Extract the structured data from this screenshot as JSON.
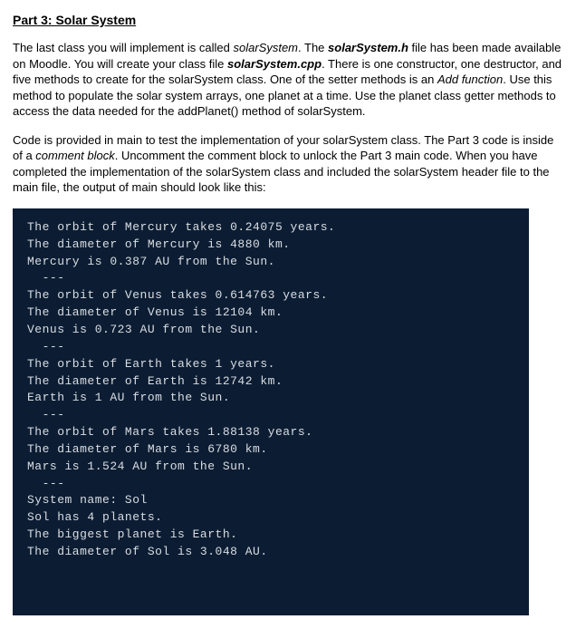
{
  "heading": "Part 3: Solar System",
  "para1": {
    "t1": "The last class you will implement is called ",
    "i1": "solarSystem",
    "t2": ". The ",
    "bi1": "solarSystem.h",
    "t3": " file has been made available on Moodle. You will create your class file ",
    "bi2": "solarSystem.cpp",
    "t4": ". There is one constructor, one destructor, and five methods to create for the solarSystem class.  One of the setter methods is an ",
    "i2": "Add function",
    "t5": ".  Use this method to populate the solar system arrays, one planet at a time.  Use the planet class getter methods to access the data needed for the addPlanet() method of solarSystem."
  },
  "para2": {
    "t1": "Code is provided in main to test the implementation of your solarSystem class.  The Part 3 code is inside of a ",
    "i1": "comment block",
    "t2": ".  Uncomment the comment block to unlock the Part 3 main code.  When you have completed the implementation of the solarSystem class and included the solarSystem header file to the main file, the output of main should look like this:"
  },
  "terminal_output": "The orbit of Mercury takes 0.24075 years.\nThe diameter of Mercury is 4880 km.\nMercury is 0.387 AU from the Sun.\n  ---\nThe orbit of Venus takes 0.614763 years.\nThe diameter of Venus is 12104 km.\nVenus is 0.723 AU from the Sun.\n  ---\nThe orbit of Earth takes 1 years.\nThe diameter of Earth is 12742 km.\nEarth is 1 AU from the Sun.\n  ---\nThe orbit of Mars takes 1.88138 years.\nThe diameter of Mars is 6780 km.\nMars is 1.524 AU from the Sun.\n  ---\nSystem name: Sol\nSol has 4 planets.\nThe biggest planet is Earth.\nThe diameter of Sol is 3.048 AU."
}
